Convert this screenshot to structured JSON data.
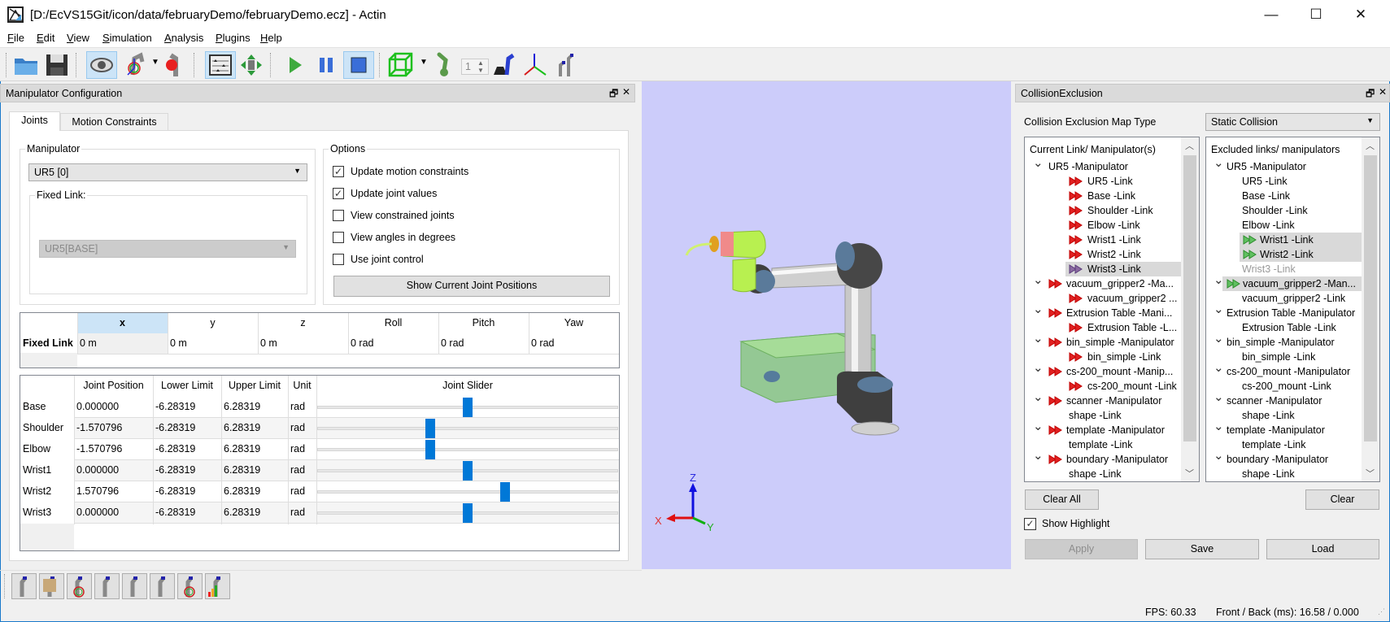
{
  "window": {
    "title": "[D:/EcVS15Git/icon/data/februaryDemo/februaryDemo.ecz] - Actin",
    "minimize": "—",
    "maximize": "☐",
    "close": "✕"
  },
  "menu": [
    "File",
    "Edit",
    "View",
    "Simulation",
    "Analysis",
    "Plugins",
    "Help"
  ],
  "toolbar": {
    "spin_value": "1",
    "icons": [
      "open-folder",
      "save",
      "eye-view",
      "robot-frames",
      "robot-ball",
      "slider-panel",
      "move-arrows",
      "play",
      "pause",
      "stop",
      "bounding-box",
      "green-robot",
      "weight-robot",
      "axes",
      "robots"
    ]
  },
  "left_panel": {
    "title": "Manipulator Configuration",
    "tabs": [
      "Joints",
      "Motion Constraints"
    ],
    "manipulator": {
      "label": "Manipulator",
      "value": "UR5 [0]",
      "fixed_link_label": "Fixed Link:",
      "fixed_link_value": "UR5[BASE]"
    },
    "options": {
      "label": "Options",
      "items": [
        {
          "label": "Update motion constraints",
          "checked": true
        },
        {
          "label": "Update joint values",
          "checked": true
        },
        {
          "label": "View constrained joints",
          "checked": false
        },
        {
          "label": "View angles in degrees",
          "checked": false
        },
        {
          "label": "Use joint control",
          "checked": false
        }
      ],
      "button": "Show Current Joint Positions"
    },
    "fixed_link_table": {
      "row_header": "Fixed Link",
      "columns": [
        "x",
        "y",
        "z",
        "Roll",
        "Pitch",
        "Yaw"
      ],
      "values": [
        "0 m",
        "0 m",
        "0 m",
        "0 rad",
        "0 rad",
        "0 rad"
      ]
    },
    "joint_table": {
      "columns": [
        "Joint Position",
        "Lower Limit",
        "Upper Limit",
        "Unit",
        "Joint Slider"
      ],
      "rows": [
        {
          "name": "Base",
          "position": "0.000000",
          "lower": "-6.28319",
          "upper": "6.28319",
          "unit": "rad",
          "value": 0.0
        },
        {
          "name": "Shoulder",
          "position": "-1.570796",
          "lower": "-6.28319",
          "upper": "6.28319",
          "unit": "rad",
          "value": -1.570796
        },
        {
          "name": "Elbow",
          "position": "-1.570796",
          "lower": "-6.28319",
          "upper": "6.28319",
          "unit": "rad",
          "value": -1.570796
        },
        {
          "name": "Wrist1",
          "position": "0.000000",
          "lower": "-6.28319",
          "upper": "6.28319",
          "unit": "rad",
          "value": 0.0
        },
        {
          "name": "Wrist2",
          "position": "1.570796",
          "lower": "-6.28319",
          "upper": "6.28319",
          "unit": "rad",
          "value": 1.570796
        },
        {
          "name": "Wrist3",
          "position": "0.000000",
          "lower": "-6.28319",
          "upper": "6.28319",
          "unit": "rad",
          "value": 0.0
        }
      ],
      "slider_min": -6.28319,
      "slider_max": 6.28319
    }
  },
  "viewport": {
    "background": "#ccccfa",
    "axes": {
      "x": "X",
      "y": "Y",
      "z": "Z"
    }
  },
  "right_panel": {
    "title": "CollisionExclusion",
    "map_type_label": "Collision Exclusion Map Type",
    "map_type_value": "Static Collision",
    "current_tree": {
      "header": "Current Link/ Manipulator(s)",
      "items": [
        {
          "label": "UR5 -Manipulator",
          "depth": 0,
          "chevron": true,
          "icon": null
        },
        {
          "label": "UR5 -Link",
          "depth": 1,
          "icon": "red"
        },
        {
          "label": "Base -Link",
          "depth": 1,
          "icon": "red"
        },
        {
          "label": "Shoulder -Link",
          "depth": 1,
          "icon": "red"
        },
        {
          "label": "Elbow -Link",
          "depth": 1,
          "icon": "red"
        },
        {
          "label": "Wrist1 -Link",
          "depth": 1,
          "icon": "red"
        },
        {
          "label": "Wrist2 -Link",
          "depth": 1,
          "icon": "red"
        },
        {
          "label": "Wrist3 -Link",
          "depth": 1,
          "icon": "purple",
          "selected": true
        },
        {
          "label": "vacuum_gripper2 -Ma...",
          "depth": 0,
          "chevron": true,
          "icon": "red"
        },
        {
          "label": "vacuum_gripper2 ...",
          "depth": 1,
          "icon": "red"
        },
        {
          "label": "Extrusion Table -Mani...",
          "depth": 0,
          "chevron": true,
          "icon": "red"
        },
        {
          "label": "Extrusion Table -L...",
          "depth": 1,
          "icon": "red"
        },
        {
          "label": "bin_simple -Manipulator",
          "depth": 0,
          "chevron": true,
          "icon": "red"
        },
        {
          "label": "bin_simple -Link",
          "depth": 1,
          "icon": "red"
        },
        {
          "label": "cs-200_mount -Manip...",
          "depth": 0,
          "chevron": true,
          "icon": "red"
        },
        {
          "label": "cs-200_mount -Link",
          "depth": 1,
          "icon": "red"
        },
        {
          "label": "scanner -Manipulator",
          "depth": 0,
          "chevron": true,
          "icon": "red"
        },
        {
          "label": "shape -Link",
          "depth": 1,
          "icon": null
        },
        {
          "label": "template -Manipulator",
          "depth": 0,
          "chevron": true,
          "icon": "red"
        },
        {
          "label": "template -Link",
          "depth": 1,
          "icon": null
        },
        {
          "label": "boundary -Manipulator",
          "depth": 0,
          "chevron": true,
          "icon": "red"
        },
        {
          "label": "shape -Link",
          "depth": 1,
          "icon": null
        }
      ]
    },
    "excluded_tree": {
      "header": "Excluded links/ manipulators",
      "items": [
        {
          "label": "UR5 -Manipulator",
          "depth": 0,
          "chevron": true,
          "icon": null
        },
        {
          "label": "UR5 -Link",
          "depth": 1,
          "icon": null
        },
        {
          "label": "Base -Link",
          "depth": 1,
          "icon": null
        },
        {
          "label": "Shoulder -Link",
          "depth": 1,
          "icon": null
        },
        {
          "label": "Elbow -Link",
          "depth": 1,
          "icon": null
        },
        {
          "label": "Wrist1 -Link",
          "depth": 1,
          "icon": "green",
          "selected": true
        },
        {
          "label": "Wrist2 -Link",
          "depth": 1,
          "icon": "green",
          "selected": true
        },
        {
          "label": "Wrist3 -Link",
          "depth": 1,
          "icon": null,
          "disabled": true
        },
        {
          "label": "vacuum_gripper2 -Man...",
          "depth": 0,
          "chevron": true,
          "icon": "green",
          "selected": true
        },
        {
          "label": "vacuum_gripper2 -Link",
          "depth": 1,
          "icon": null
        },
        {
          "label": "Extrusion Table -Manipulator",
          "depth": 0,
          "chevron": true,
          "icon": null
        },
        {
          "label": "Extrusion Table -Link",
          "depth": 1,
          "icon": null
        },
        {
          "label": "bin_simple -Manipulator",
          "depth": 0,
          "chevron": true,
          "icon": null
        },
        {
          "label": "bin_simple -Link",
          "depth": 1,
          "icon": null
        },
        {
          "label": "cs-200_mount -Manipulator",
          "depth": 0,
          "chevron": true,
          "icon": null
        },
        {
          "label": "cs-200_mount -Link",
          "depth": 1,
          "icon": null
        },
        {
          "label": "scanner -Manipulator",
          "depth": 0,
          "chevron": true,
          "icon": null
        },
        {
          "label": "shape -Link",
          "depth": 1,
          "icon": null
        },
        {
          "label": "template -Manipulator",
          "depth": 0,
          "chevron": true,
          "icon": null
        },
        {
          "label": "template -Link",
          "depth": 1,
          "icon": null
        },
        {
          "label": "boundary -Manipulator",
          "depth": 0,
          "chevron": true,
          "icon": null
        },
        {
          "label": "shape -Link",
          "depth": 1,
          "icon": null
        }
      ]
    },
    "clear_all": "Clear All",
    "clear": "Clear",
    "show_highlight": {
      "label": "Show Highlight",
      "checked": true
    },
    "apply": "Apply",
    "save": "Save",
    "load": "Load"
  },
  "bottom_toolbar": {
    "icons": [
      "robot",
      "box-frames",
      "frames",
      "robot-axes",
      "robot-monitor",
      "robot-network",
      "speed-line",
      "robot-bars"
    ]
  },
  "status": {
    "fps": "FPS: 60.33",
    "front_back": "Front / Back (ms):  16.58 / 0.000"
  },
  "colors": {
    "accent": "#0078d7",
    "selection": "#cce4f7",
    "slider_handle": "#0078d7"
  }
}
